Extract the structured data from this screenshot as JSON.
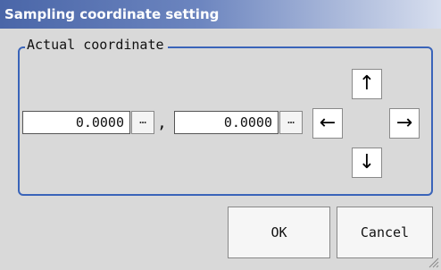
{
  "window": {
    "title": "Sampling coordinate setting"
  },
  "group": {
    "label": "Actual coordinate"
  },
  "x_field": {
    "value": "0.0000",
    "ellipsis": "…"
  },
  "separator": ",",
  "y_field": {
    "value": "0.0000",
    "ellipsis": "…"
  },
  "arrows": {
    "up": "↑",
    "left": "←",
    "right": "→",
    "down": "↓"
  },
  "buttons": {
    "ok": "OK",
    "cancel": "Cancel"
  }
}
